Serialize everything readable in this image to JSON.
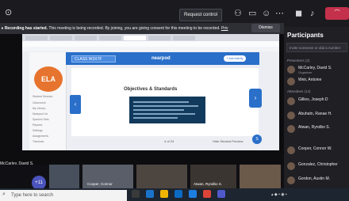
{
  "meeting": {
    "request_control_label": "Request control",
    "leave_label": "⌒",
    "recording_banner": {
      "title": "Recording has started.",
      "message": "This meeting is being recorded. By joining, you are giving consent for this meeting to be recorded.",
      "link": "Priv",
      "dismiss_label": "Dismiss"
    }
  },
  "participants": {
    "title": "Participants",
    "search_placeholder": "Invite someone or dial a number",
    "presenters_label": "Presenters (2)",
    "attendees_label": "Attendees (14)",
    "presenters": [
      {
        "name": "McCarley, David S.",
        "sub": "Organizer"
      },
      {
        "name": "Weir, Antoine",
        "sub": ""
      }
    ],
    "attendees": [
      {
        "name": "Gillies, Joseph D"
      },
      {
        "name": "Abuhatn, Ranae H."
      },
      {
        "name": "Atwan, Ryndbo S."
      },
      {
        "name": "Cooper, Connor W."
      },
      {
        "name": "Gonzalez, Christopher"
      },
      {
        "name": "Gordon, Austin M."
      }
    ]
  },
  "shared_screen": {
    "code": "CLASS W3X7F",
    "app_name": "nearpod",
    "add_activity_label": "+ Add Activity",
    "logo_text": "ELA",
    "sidebar_items": [
      "Student Session",
      "Classroom",
      "My Library",
      "Nearpod Lib",
      "Spanish Sets",
      "Reports",
      "Settings",
      "Assignments",
      "Trashcan"
    ],
    "slide_title": "Objectives & Standards",
    "slide_counter": "4 of 23",
    "hide_controls_label": "Hide Student Preview",
    "help_label": "S"
  },
  "presenter_label": "McCarley, David S.",
  "videos": [
    {
      "name": "Cooper, Connor"
    },
    {
      "name": "Atwan, Ryndbo S."
    }
  ],
  "more_participants": "+11",
  "taskbar": {
    "search_placeholder": "Type here to search"
  }
}
